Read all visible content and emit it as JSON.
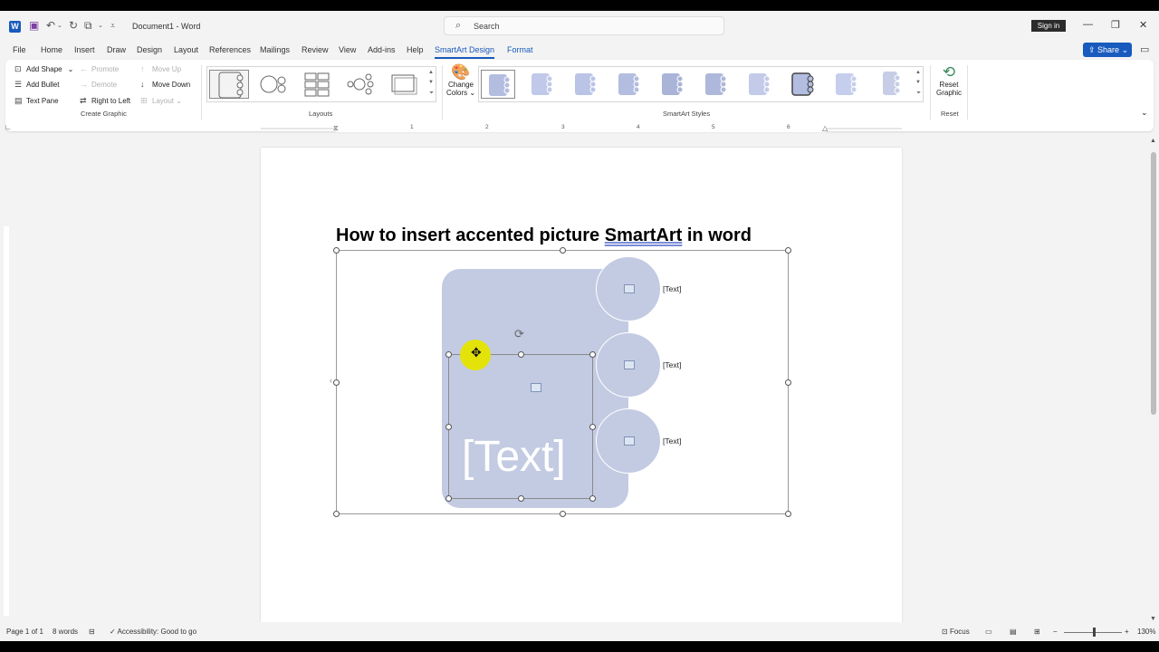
{
  "titlebar": {
    "doc_title": "Document1 - Word",
    "search_placeholder": "Search",
    "signin_label": "Sign in"
  },
  "menu": {
    "tabs": [
      "File",
      "Home",
      "Insert",
      "Draw",
      "Design",
      "Layout",
      "References",
      "Mailings",
      "Review",
      "View",
      "Add-ins",
      "Help",
      "SmartArt Design",
      "Format"
    ],
    "share_label": "Share"
  },
  "ribbon": {
    "create_graphic": {
      "add_shape": "Add Shape",
      "add_bullet": "Add Bullet",
      "text_pane": "Text Pane",
      "promote": "Promote",
      "demote": "Demote",
      "right_to_left": "Right to Left",
      "move_up": "Move Up",
      "move_down": "Move Down",
      "layout": "Layout",
      "group_label": "Create Graphic"
    },
    "layouts_label": "Layouts",
    "change_colors": [
      "Change",
      "Colors"
    ],
    "smartart_styles_label": "SmartArt Styles",
    "reset_graphic": [
      "Reset",
      "Graphic"
    ],
    "reset_label": "Reset"
  },
  "ruler": {
    "marks": [
      "1",
      "1",
      "2",
      "3",
      "4",
      "5",
      "6"
    ]
  },
  "document": {
    "heading_prefix": "How to insert accented picture ",
    "heading_smartart": "SmartArt",
    "heading_suffix": "  in word",
    "smartart": {
      "main_text": "[Text]",
      "side_texts": [
        "[Text]",
        "[Text]",
        "[Text]"
      ],
      "fill_color": "#c3cbe3"
    }
  },
  "status": {
    "page": "Page 1 of 1",
    "words": "8 words",
    "accessibility": "Accessibility: Good to go",
    "focus": "Focus",
    "zoom": "130%"
  }
}
